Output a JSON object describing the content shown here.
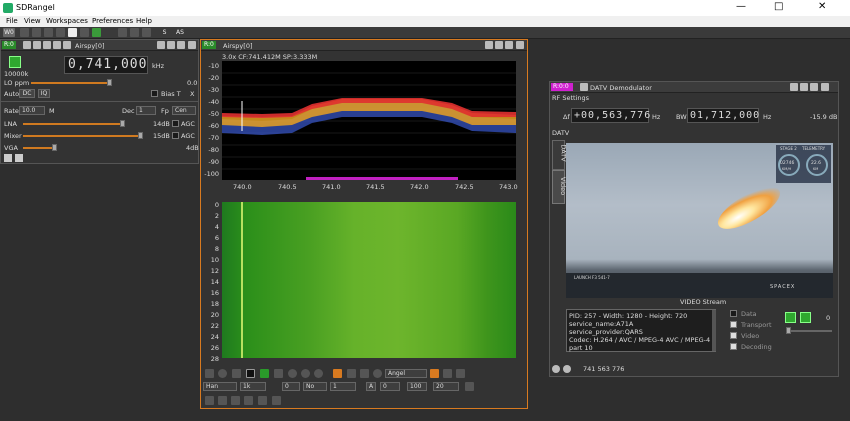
{
  "app": {
    "title": "SDRangel",
    "min": "—",
    "max": "□",
    "close": "✕"
  },
  "menu": [
    "File",
    "View",
    "Workspaces",
    "Preferences",
    "Help"
  ],
  "toolbar": {
    "w_label": "W0",
    "s_label": "S",
    "as_label": "AS"
  },
  "airspy_panel": {
    "tag": "R:0",
    "title": "Airspy[0]",
    "frequency": "0,741,000",
    "freq_unit": "kHz",
    "sample_rate": "10000k",
    "lo_ppm_label": "LO ppm",
    "lo_ppm_value": "0.0",
    "auto_label": "Auto",
    "dc_label": "DC",
    "iq_label": "IQ",
    "bias_label": "Bias T",
    "x_label": "X",
    "rate_label": "Rate",
    "rate_value": "10.0",
    "rate_unit": "M",
    "dec_label": "Dec",
    "dec_value": "1",
    "fp_label": "Fp",
    "fp_value": "Cen",
    "lna_label": "LNA",
    "lna_value": "14dB",
    "lna_level_pct": 85,
    "mixer_label": "Mixer",
    "mixer_value": "15dB",
    "mixer_level_pct": 100,
    "vga_label": "VGA",
    "vga_value": "4dB",
    "vga_level_pct": 27,
    "agc_label": "AGC"
  },
  "spectrum_panel": {
    "tag": "R:0",
    "title": "Airspy[0]",
    "info": "3.0x CF:741.412M SP:3.333M",
    "y_ticks": [
      "-10",
      "-20",
      "-30",
      "-40",
      "-50",
      "-60",
      "-70",
      "-80",
      "-90",
      "-100"
    ],
    "x_ticks": [
      "740.0",
      "740.5",
      "741.0",
      "741.5",
      "742.0",
      "742.5",
      "743.0"
    ],
    "waterfall_ticks": [
      "0",
      "2",
      "4",
      "6",
      "8",
      "10",
      "12",
      "14",
      "16",
      "18",
      "20",
      "22",
      "24",
      "26",
      "28"
    ],
    "window_value": "Han",
    "fft_size": "1k",
    "ref_value": "0",
    "avg_value": "No",
    "avg_count": "1",
    "a_label": "A",
    "min_val": "0",
    "max_val": "100",
    "range_val": "20",
    "palette": "Angel"
  },
  "datv_panel": {
    "tag": "R:0:0",
    "title": "DATV Demodulator",
    "rf_section": "RF Settings",
    "delta_label": "Δf",
    "delta_freq": "+00,563,776",
    "hz1": "Hz",
    "bw_label": "BW",
    "bw_freq": "01,712,000",
    "hz2": "Hz",
    "power": "-15.9 dB",
    "datv_section": "DATV",
    "tab_datv": "DATV",
    "tab_video": "Video",
    "video_stream_label": "VIDEO Stream",
    "stream_info": [
      "PID: 257 - Width: 1280 - Height: 720",
      "service_name:A71A",
      "service_provider:QARS",
      "Codec: H.264 / AVC / MPEG-4 AVC / MPEG-4",
      "part 10"
    ],
    "cb_data": "Data",
    "cb_transport": "Transport",
    "cb_video": "Video",
    "cb_decoding": "Decoding",
    "volume": "0",
    "status_freq": "741 563 776",
    "overlay": {
      "stage": "STAGE 2",
      "telemetry": "TELEMETRY",
      "speed": "02746",
      "speed_unit": "KM/H",
      "alt": "22.6",
      "alt_unit": "KM",
      "launch": "LAUNCH F3 541-7",
      "brand": "SPACEX"
    }
  }
}
